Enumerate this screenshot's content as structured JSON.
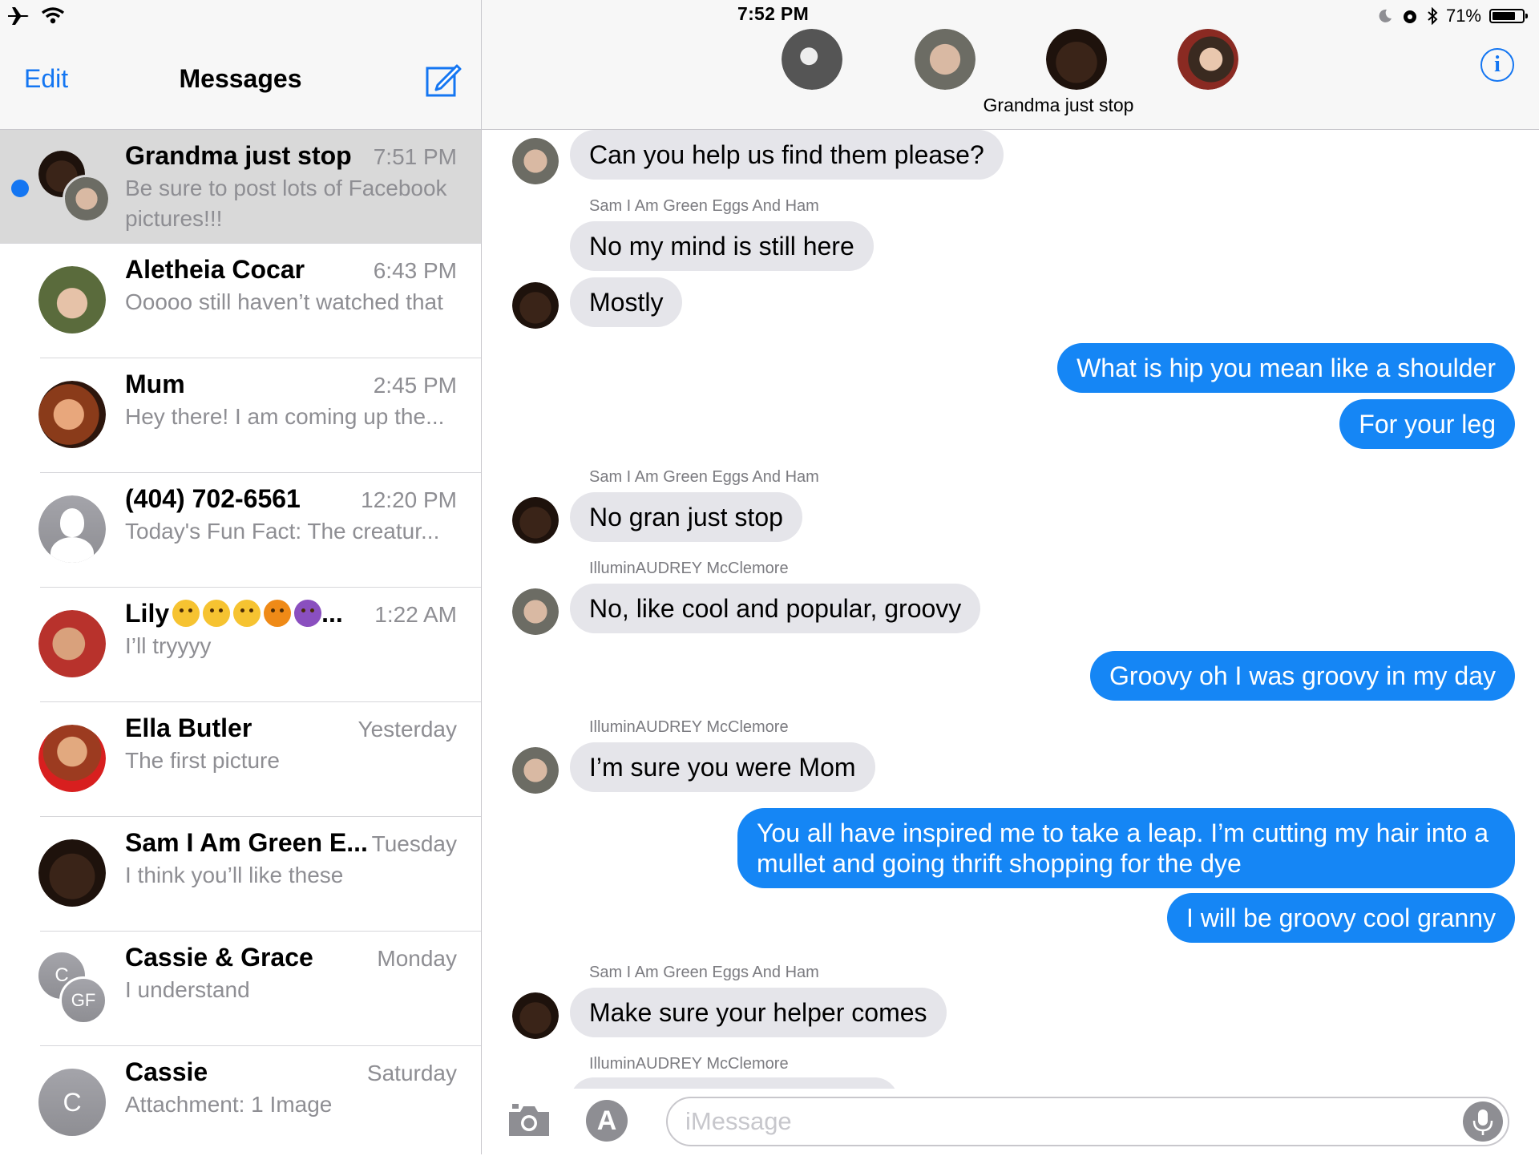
{
  "status_bar": {
    "time": "7:52 PM",
    "battery": "71%"
  },
  "sidebar": {
    "edit_label": "Edit",
    "title": "Messages",
    "conversations": [
      {
        "name": "Grandma just stop",
        "time": "7:51 PM",
        "preview": "Be sure to post lots of Facebook pictures!!!",
        "unread": true
      },
      {
        "name": "Aletheia Cocar",
        "time": "6:43 PM",
        "preview": "Ooooo still haven’t watched that"
      },
      {
        "name": "Mum",
        "time": "2:45 PM",
        "preview": "Hey there! I am coming up the..."
      },
      {
        "name": "(404) 702-6561",
        "time": "12:20 PM",
        "preview": "Today's Fun Fact: The creatur..."
      },
      {
        "name": "Lily",
        "name_suffix": "...",
        "time": "1:22 AM",
        "preview": "I’ll tryyyy"
      },
      {
        "name": "Ella Butler",
        "time": "Yesterday",
        "preview": "The first picture"
      },
      {
        "name": "Sam I Am Green E...",
        "time": "Tuesday",
        "preview": "I think you’ll like these"
      },
      {
        "name": "Cassie & Grace",
        "time": "Monday",
        "preview": "I understand",
        "initials_a": "C",
        "initials_b": "GF"
      },
      {
        "name": "Cassie",
        "time": "Saturday",
        "preview": "Attachment: 1 Image",
        "initials": "C"
      }
    ]
  },
  "chat": {
    "group_name": "Grandma just stop",
    "messages": [
      {
        "dir": "in",
        "text": "Can you help us find them please?"
      },
      {
        "dir": "in",
        "sender": "Sam I Am Green Eggs And Ham",
        "text": "No my mind is still here"
      },
      {
        "dir": "in",
        "text": "Mostly"
      },
      {
        "dir": "out",
        "text": "What is hip you mean like a shoulder"
      },
      {
        "dir": "out",
        "text": "For your leg"
      },
      {
        "dir": "in",
        "sender": "Sam I Am Green Eggs And Ham",
        "text": "No gran just stop"
      },
      {
        "dir": "in",
        "sender": "IlluminAUDREY McClemore",
        "text": "No, like cool and popular, groovy"
      },
      {
        "dir": "out",
        "text": "Groovy oh I was groovy in my day"
      },
      {
        "dir": "in",
        "sender": "IlluminAUDREY McClemore",
        "text": "I’m sure you were Mom"
      },
      {
        "dir": "out",
        "text": "You all have inspired me to take a leap. I’m cutting my hair into a mullet and going thrift shopping for the dye"
      },
      {
        "dir": "out",
        "text": "I will be groovy cool granny"
      },
      {
        "dir": "in",
        "sender": "Sam I Am Green Eggs And Ham",
        "text": "Make sure your helper comes"
      },
      {
        "dir": "in",
        "sender": "IlluminAUDREY McClemore",
        "text": ""
      }
    ]
  },
  "input": {
    "placeholder": "iMessage"
  },
  "icons": [
    "airplane-icon",
    "wifi-icon",
    "moon-icon",
    "alarm-icon",
    "bluetooth-icon",
    "battery-icon",
    "compose-icon",
    "info-icon",
    "camera-icon",
    "app-store-icon",
    "microphone-icon"
  ],
  "colors": {
    "accent": "#1476f2",
    "outgoing_bubble": "#1586f5",
    "incoming_bubble": "#e5e5ea",
    "selected_row": "#d9d9d9",
    "unread_dot": "#1476f2"
  }
}
